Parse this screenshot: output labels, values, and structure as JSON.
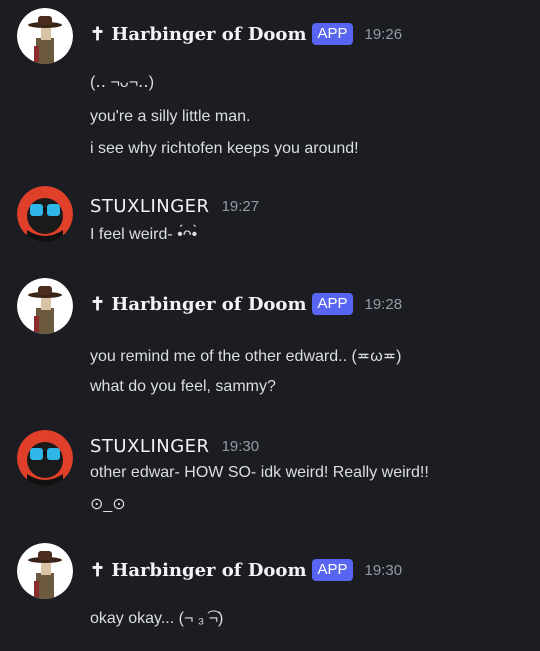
{
  "messages": [
    {
      "author": "✝ Harbinger of Doom",
      "badge": "APP",
      "time": "19:26",
      "lines": [
        "(‥ ¬ᴗ¬‥)",
        "you're a silly little man.",
        "i see why richtofen keeps you around!"
      ]
    },
    {
      "author": "STUXLINGER",
      "time": "19:27",
      "lines": [
        "I feel weird- •́ᴖ•̀"
      ]
    },
    {
      "author": "✝ Harbinger of Doom",
      "badge": "APP",
      "time": "19:28",
      "lines": [
        "you remind me of the other edward.. (≖ω≖)",
        "what do you feel, sammy?"
      ]
    },
    {
      "author": "STUXLINGER",
      "time": "19:30",
      "lines": [
        "other edwar- HOW SO- idk weird! Really weird!!",
        "⊙_⊙"
      ]
    },
    {
      "author": "✝ Harbinger of Doom",
      "badge": "APP",
      "time": "19:30",
      "lines": [
        "okay okay... (¬ ₃ ͡¬)"
      ]
    }
  ],
  "colors": {
    "background": "#1c1d22",
    "app_badge": "#5865f2",
    "timestamp": "#949ba4"
  },
  "avatars": {
    "harbinger": "cowboy-hat-man-avatar",
    "stuxlinger": "red-goggles-avatar"
  }
}
